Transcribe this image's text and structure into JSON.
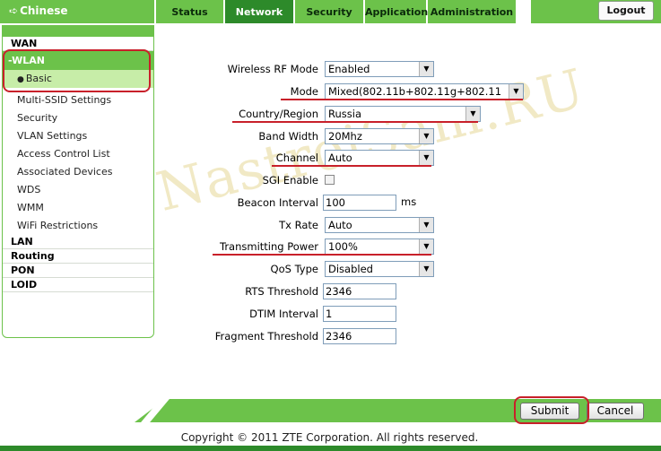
{
  "header": {
    "language_label": "Chinese",
    "tabs": [
      {
        "label": "Status"
      },
      {
        "label": "Network"
      },
      {
        "label": "Security"
      },
      {
        "label": "Application"
      },
      {
        "label": "Administration"
      }
    ],
    "active_tab": "Network",
    "logout_label": "Logout"
  },
  "sidebar": {
    "wan": "WAN",
    "wlan": "-WLAN",
    "wlan_items": [
      "Basic",
      "Multi-SSID Settings",
      "Security",
      "VLAN Settings",
      "Access Control List",
      "Associated Devices",
      "WDS",
      "WMM",
      "WiFi Restrictions"
    ],
    "active_item": "Basic",
    "lan": "LAN",
    "routing": "Routing",
    "pon": "PON",
    "loid": "LOID"
  },
  "form": {
    "wireless_rf_mode": {
      "label": "Wireless RF Mode",
      "value": "Enabled"
    },
    "mode": {
      "label": "Mode",
      "value": "Mixed(802.11b+802.11g+802.11"
    },
    "country_region": {
      "label": "Country/Region",
      "value": "Russia"
    },
    "band_width": {
      "label": "Band Width",
      "value": "20Mhz"
    },
    "channel": {
      "label": "Channel",
      "value": "Auto"
    },
    "sgi_enable": {
      "label": "SGI Enable",
      "checked": false
    },
    "beacon_interval": {
      "label": "Beacon Interval",
      "value": "100",
      "unit": "ms"
    },
    "tx_rate": {
      "label": "Tx Rate",
      "value": "Auto"
    },
    "transmitting_power": {
      "label": "Transmitting Power",
      "value": "100%"
    },
    "qos_type": {
      "label": "QoS Type",
      "value": "Disabled"
    },
    "rts_threshold": {
      "label": "RTS Threshold",
      "value": "2346"
    },
    "dtim_interval": {
      "label": "DTIM Interval",
      "value": "1"
    },
    "fragment_threshold": {
      "label": "Fragment Threshold",
      "value": "2346"
    }
  },
  "actions": {
    "submit_label": "Submit",
    "cancel_label": "Cancel"
  },
  "footer": {
    "copyright": "Copyright © 2011 ZTE Corporation. All rights reserved."
  },
  "watermark": "NastroiSam.RU",
  "colors": {
    "accent": "#6cc24a",
    "accent_dark": "#2d8a2a",
    "highlight": "#c8202a"
  }
}
